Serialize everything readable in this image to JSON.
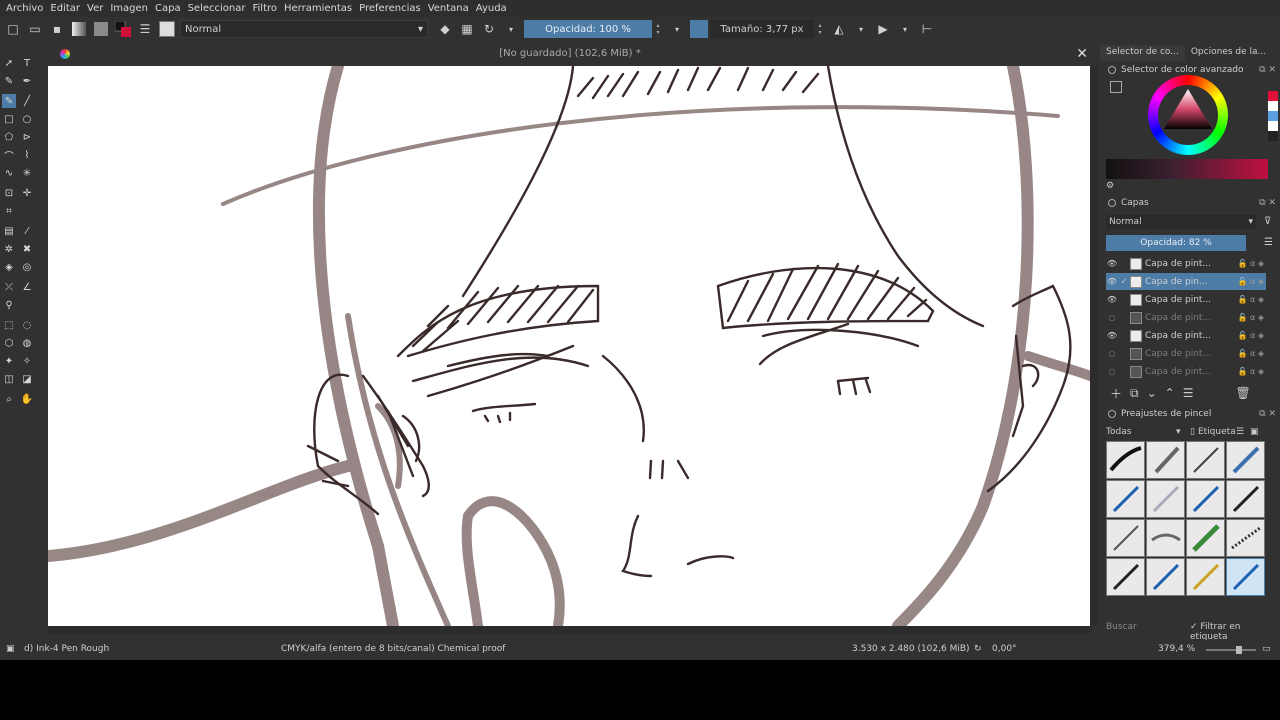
{
  "menu": [
    "Archivo",
    "Editar",
    "Ver",
    "Imagen",
    "Capa",
    "Seleccionar",
    "Filtro",
    "Herramientas",
    "Preferencias",
    "Ventana",
    "Ayuda"
  ],
  "toolbar": {
    "blend_mode": "Normal",
    "opacity_label": "Opacidad: 100 %",
    "size_label": "Tamaño: 3,77 px"
  },
  "document": {
    "title": "[No guardado]  (102,6 MiB) *"
  },
  "dock": {
    "tabs": [
      "Selector de co...",
      "Opciones de la..."
    ],
    "color_panel_title": "Selector de color avanzado",
    "layers_panel_title": "Capas",
    "layers_blend": "Normal",
    "layers_opacity": "Opacidad:  82 %",
    "layers": [
      {
        "name": "Capa de pint...",
        "visible": true,
        "selected": false
      },
      {
        "name": "Capa de pin...",
        "visible": true,
        "selected": true
      },
      {
        "name": "Capa de pint...",
        "visible": true,
        "selected": false
      },
      {
        "name": "Capa de pint...",
        "visible": false,
        "selected": false
      },
      {
        "name": "Capa de pint...",
        "visible": true,
        "selected": false
      },
      {
        "name": "Capa de pint...",
        "visible": false,
        "selected": false
      },
      {
        "name": "Capa de pint...",
        "visible": false,
        "selected": false
      }
    ],
    "brush_panel_title": "Preajustes de pincel",
    "brush_filter": "Todas",
    "brush_tag": "Etiqueta",
    "search_placeholder": "Buscar",
    "filter_tag_label": "Filtrar en etiqueta"
  },
  "status": {
    "brush_name": "d) Ink-4 Pen Rough",
    "color_info": "CMYK/alfa (entero de 8 bits/canal)  Chemical proof",
    "dimensions": "3.530 x 2.480 (102,6 MiB)",
    "rotation": "0,00°",
    "zoom": "379,4 %"
  },
  "colors": {
    "accent": "#4d7ca6",
    "ui_bg": "#313131",
    "ink": "#3a2a2a",
    "sketch": "#8c7a78"
  }
}
